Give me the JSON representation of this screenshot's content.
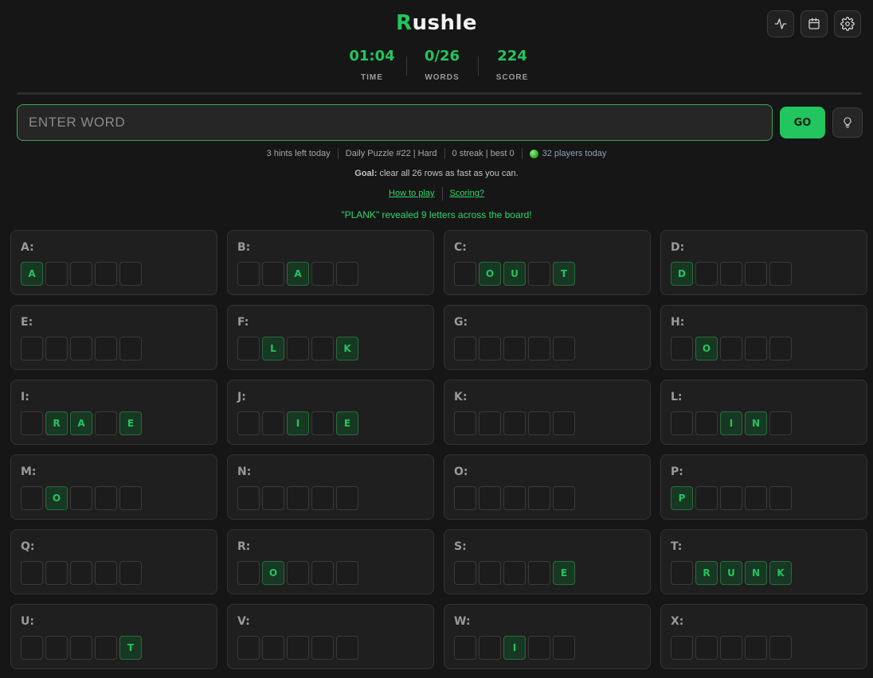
{
  "header": {
    "logo_first": "R",
    "logo_rest": "ushle",
    "icons": [
      "activity-icon",
      "calendar-icon",
      "gear-icon"
    ]
  },
  "stats": {
    "time": {
      "value": "01:04",
      "label": "TIME"
    },
    "words": {
      "value": "0/26",
      "label": "WORDS"
    },
    "score": {
      "value": "224",
      "label": "SCORE"
    }
  },
  "input": {
    "placeholder": "ENTER WORD",
    "value": "",
    "go_label": "GO",
    "hint_icon": "lightbulb-icon"
  },
  "info": {
    "hints": "3 hints left today",
    "puzzle": "Daily Puzzle #22 | Hard",
    "streak": "0 streak | best 0",
    "players": "32 players today"
  },
  "goal": {
    "label": "Goal:",
    "text": " clear all 26 rows as fast as you can."
  },
  "links": {
    "how_to_play": "How to play",
    "scoring": "Scoring?"
  },
  "message": "\"PLANK\" revealed 9 letters across the board!",
  "colors": {
    "accent": "#22c55e",
    "background": "#161616",
    "card": "#1f1f1f"
  },
  "board": [
    {
      "label": "A:",
      "tiles": [
        "A",
        "",
        "",
        "",
        ""
      ]
    },
    {
      "label": "B:",
      "tiles": [
        "",
        "",
        "A",
        "",
        ""
      ]
    },
    {
      "label": "C:",
      "tiles": [
        "",
        "O",
        "U",
        "",
        "T"
      ]
    },
    {
      "label": "D:",
      "tiles": [
        "D",
        "",
        "",
        "",
        ""
      ]
    },
    {
      "label": "E:",
      "tiles": [
        "",
        "",
        "",
        "",
        ""
      ]
    },
    {
      "label": "F:",
      "tiles": [
        "",
        "L",
        "",
        "",
        "K"
      ]
    },
    {
      "label": "G:",
      "tiles": [
        "",
        "",
        "",
        "",
        ""
      ]
    },
    {
      "label": "H:",
      "tiles": [
        "",
        "O",
        "",
        "",
        ""
      ]
    },
    {
      "label": "I:",
      "tiles": [
        "",
        "R",
        "A",
        "",
        "E"
      ]
    },
    {
      "label": "J:",
      "tiles": [
        "",
        "",
        "I",
        "",
        "E"
      ]
    },
    {
      "label": "K:",
      "tiles": [
        "",
        "",
        "",
        "",
        ""
      ]
    },
    {
      "label": "L:",
      "tiles": [
        "",
        "",
        "I",
        "N",
        ""
      ]
    },
    {
      "label": "M:",
      "tiles": [
        "",
        "O",
        "",
        "",
        ""
      ]
    },
    {
      "label": "N:",
      "tiles": [
        "",
        "",
        "",
        "",
        ""
      ]
    },
    {
      "label": "O:",
      "tiles": [
        "",
        "",
        "",
        "",
        ""
      ]
    },
    {
      "label": "P:",
      "tiles": [
        "P",
        "",
        "",
        "",
        ""
      ]
    },
    {
      "label": "Q:",
      "tiles": [
        "",
        "",
        "",
        "",
        ""
      ]
    },
    {
      "label": "R:",
      "tiles": [
        "",
        "O",
        "",
        "",
        ""
      ]
    },
    {
      "label": "S:",
      "tiles": [
        "",
        "",
        "",
        "",
        "E"
      ]
    },
    {
      "label": "T:",
      "tiles": [
        "",
        "R",
        "U",
        "N",
        "K"
      ]
    },
    {
      "label": "U:",
      "tiles": [
        "",
        "",
        "",
        "",
        "T"
      ]
    },
    {
      "label": "V:",
      "tiles": [
        "",
        "",
        "",
        "",
        ""
      ]
    },
    {
      "label": "W:",
      "tiles": [
        "",
        "",
        "I",
        "",
        ""
      ]
    },
    {
      "label": "X:",
      "tiles": [
        "",
        "",
        "",
        "",
        ""
      ]
    }
  ]
}
